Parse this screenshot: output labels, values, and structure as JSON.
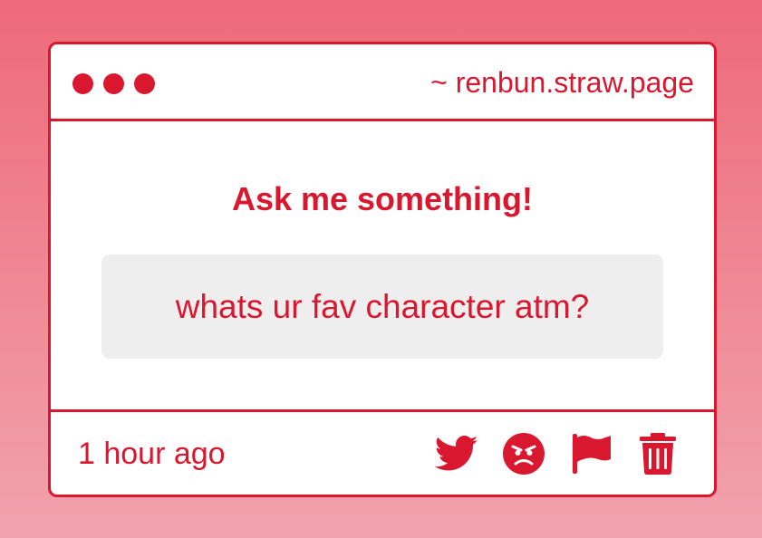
{
  "window": {
    "url": "~ renbun.straw.page"
  },
  "main": {
    "heading": "Ask me something!",
    "question": "whats ur fav character atm?"
  },
  "footer": {
    "timestamp": "1 hour ago",
    "actions": [
      {
        "icon": "twitter-icon"
      },
      {
        "icon": "angry-face-icon"
      },
      {
        "icon": "flag-icon"
      },
      {
        "icon": "trash-icon"
      }
    ]
  },
  "colors": {
    "accent": "#d9182f",
    "background_top": "#ee6a7a",
    "background_bottom": "#f1a3ad",
    "question_box": "#efeeef"
  }
}
